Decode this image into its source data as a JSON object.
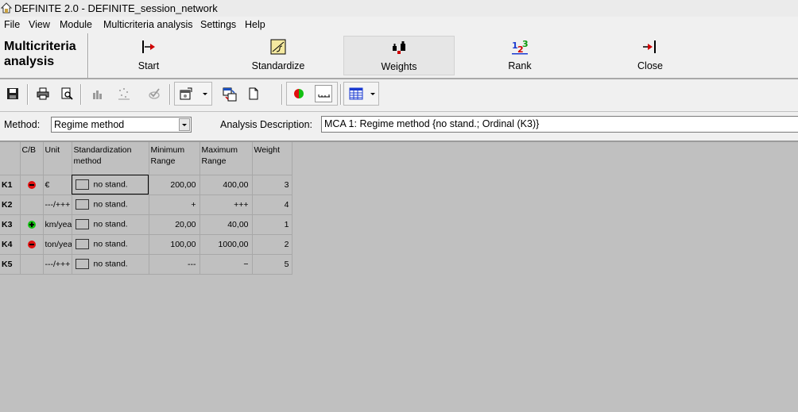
{
  "window": {
    "title": "DEFINITE 2.0 - DEFINITE_session_network"
  },
  "menu": [
    "File",
    "View",
    "Module",
    "Multicriteria analysis",
    "Settings",
    "Help"
  ],
  "module": {
    "title_line1": "Multicriteria",
    "title_line2": "analysis"
  },
  "big_toolbar": {
    "buttons": [
      {
        "label": "Start",
        "icon": "start-arrow-icon"
      },
      {
        "label": "Standardize",
        "icon": "standardize-icon"
      },
      {
        "label": "Weights",
        "icon": "weights-icon",
        "active": true
      },
      {
        "label": "Rank",
        "icon": "rank-123-icon"
      },
      {
        "label": "Close",
        "icon": "close-arrow-icon"
      }
    ]
  },
  "icon_toolbar": {
    "icons": [
      "save-icon",
      "print-icon",
      "print-preview-icon",
      "chart-icon",
      "scatter-icon",
      "check-icon",
      "properties-icon",
      "copy-data-icon",
      "new-document-icon",
      "cost-benefit-icon",
      "scale-icon",
      "table-icon"
    ]
  },
  "method": {
    "label": "Method:",
    "value": "Regime method",
    "description_label": "Analysis Description:",
    "description_value": "MCA 1: Regime method {no stand.; Ordinal (K3)}"
  },
  "grid": {
    "headers": {
      "cb": "C/B",
      "unit": "Unit",
      "std_line1": "Standardization",
      "std_line2": "method",
      "min_line1": "Minimum",
      "min_line2": "Range",
      "max_line1": "Maximum",
      "max_line2": "Range",
      "weight": "Weight"
    },
    "rows": [
      {
        "id": "K1",
        "cb": "cost",
        "unit": "€",
        "std": "no stand.",
        "min": "200,00",
        "max": "400,00",
        "weight": "3"
      },
      {
        "id": "K2",
        "cb": "",
        "unit": "---/+++",
        "std": "no stand.",
        "min": "+",
        "max": "+++",
        "weight": "4"
      },
      {
        "id": "K3",
        "cb": "benefit",
        "unit": "km/year",
        "std": "no stand.",
        "min": "20,00",
        "max": "40,00",
        "weight": "1"
      },
      {
        "id": "K4",
        "cb": "cost",
        "unit": "ton/year",
        "std": "no stand.",
        "min": "100,00",
        "max": "1000,00",
        "weight": "2"
      },
      {
        "id": "K5",
        "cb": "",
        "unit": "---/+++",
        "std": "no stand.",
        "min": "---",
        "max": "−",
        "weight": "5"
      }
    ]
  },
  "colors": {
    "cost": "#e01010",
    "benefit": "#12c012",
    "background": "#c0c0c0"
  }
}
